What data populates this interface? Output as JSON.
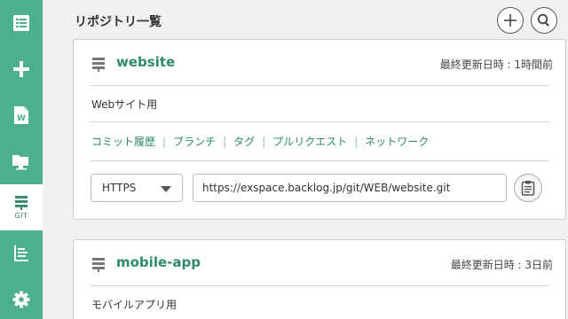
{
  "sidebar": {
    "items": [
      {
        "icon": "list-icon"
      },
      {
        "icon": "plus-icon"
      },
      {
        "icon": "wiki-document-icon"
      },
      {
        "icon": "folder-icon"
      },
      {
        "icon": "git-repository-icon",
        "label": "GIT",
        "active": true
      },
      {
        "icon": "file-tree-icon"
      },
      {
        "icon": "gear-icon"
      }
    ],
    "colors": {
      "background": "#4caf8e",
      "active_background": "#ffffff"
    }
  },
  "header": {
    "title": "リポジトリ一覧"
  },
  "repositories": [
    {
      "name": "website",
      "updated": "最終更新日時 : 1時間前",
      "description": "Webサイト用",
      "links": [
        "コミット履歴",
        "ブランチ",
        "タグ",
        "プルリクエスト",
        "ネットワーク"
      ],
      "protocol": "HTTPS",
      "url": "https://exspace.backlog.jp/git/WEB/website.git"
    },
    {
      "name": "mobile-app",
      "updated": "最終更新日時 : 3日前",
      "description": "モバイルアプリ用"
    }
  ],
  "colors": {
    "accent": "#2e8a6e",
    "page_bg": "#f0f0f0"
  }
}
